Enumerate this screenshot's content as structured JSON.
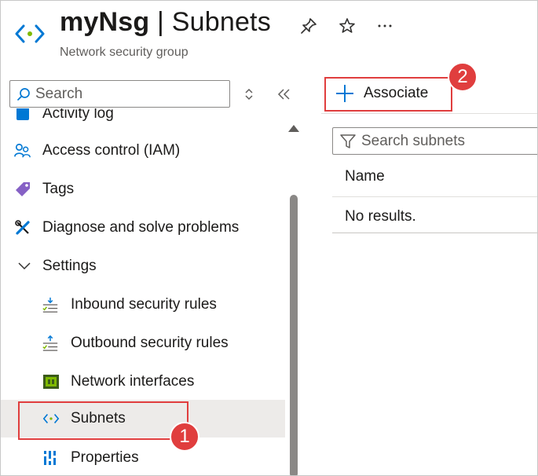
{
  "header": {
    "resource_name": "myNsg",
    "separator": "|",
    "page_name": "Subnets",
    "subtitle": "Network security group",
    "icons": [
      "pin-icon",
      "star-icon",
      "more-options-icon"
    ]
  },
  "sidebar": {
    "search_placeholder": "Search",
    "items": [
      {
        "label": "Activity log",
        "icon": "activity-log-icon"
      },
      {
        "label": "Access control (IAM)",
        "icon": "people-icon"
      },
      {
        "label": "Tags",
        "icon": "tag-icon"
      },
      {
        "label": "Diagnose and solve problems",
        "icon": "wrench-icon"
      },
      {
        "label": "Settings",
        "icon": "chevron-down-icon"
      },
      {
        "label": "Inbound security rules",
        "icon": "inbound-rules-icon"
      },
      {
        "label": "Outbound security rules",
        "icon": "outbound-rules-icon"
      },
      {
        "label": "Network interfaces",
        "icon": "network-interface-icon"
      },
      {
        "label": "Subnets",
        "icon": "subnet-icon",
        "selected": true
      },
      {
        "label": "Properties",
        "icon": "properties-icon"
      }
    ]
  },
  "toolbar": {
    "associate_label": "Associate"
  },
  "main": {
    "filter_placeholder": "Search subnets",
    "columns": [
      "Name"
    ],
    "empty_message": "No results."
  },
  "annotations": {
    "badge1": "1",
    "badge2": "2"
  },
  "colors": {
    "accent": "#0078d4",
    "callout": "#e03e3e",
    "selected_bg": "#edebe9"
  }
}
